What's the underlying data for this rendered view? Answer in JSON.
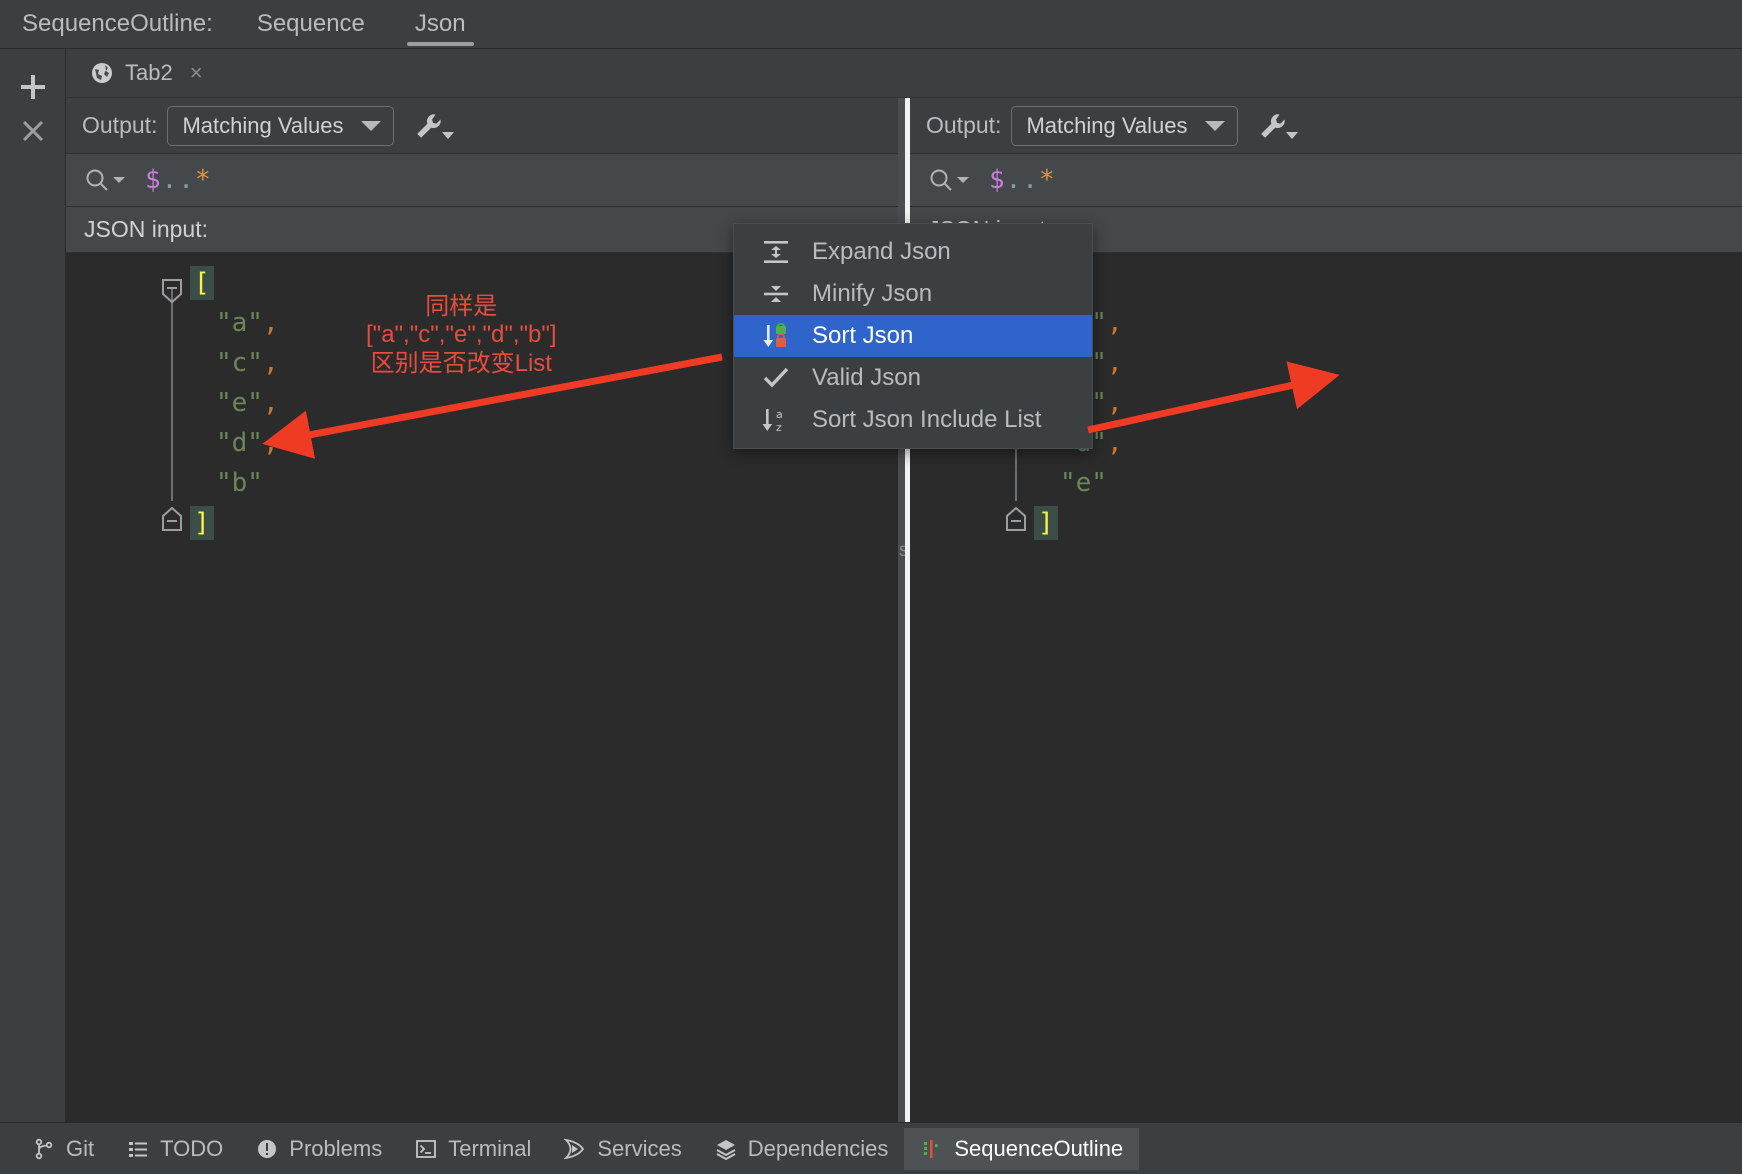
{
  "window": {
    "tool_window_title": "SequenceOutline:",
    "tabs": [
      {
        "label": "Sequence",
        "active": false
      },
      {
        "label": "Json",
        "active": true
      }
    ]
  },
  "rail": {
    "add_label": "+",
    "close_label": "×"
  },
  "editor_tabs": [
    {
      "label": "Tab2",
      "icon": "globe-icon",
      "close": "×"
    }
  ],
  "panes": {
    "left": {
      "output_label": "Output:",
      "output_value": "Matching Values",
      "wrench_icon": "wrench-icon",
      "search_placeholder": "$..*",
      "search_expression": "$..*",
      "json_input_label": "JSON input:",
      "code": {
        "open_bracket": "[",
        "close_bracket": "]",
        "items": [
          "\"a\"",
          "\"c\"",
          "\"e\"",
          "\"d\"",
          "\"b\""
        ],
        "separator": ","
      }
    },
    "right": {
      "output_label": "Output:",
      "output_value": "Matching Values",
      "wrench_icon": "wrench-icon",
      "search_placeholder": "$..*",
      "search_expression": "$..*",
      "json_input_label": "JSON input:",
      "code": {
        "open_bracket": "[",
        "close_bracket": "]",
        "items": [
          "\"a\"",
          "\"b\"",
          "\"c\"",
          "\"d\"",
          "\"e\""
        ],
        "separator": ","
      }
    }
  },
  "divider": {
    "mark": "s"
  },
  "context_menu": {
    "items": [
      {
        "label": "Expand Json",
        "icon": "expand-json-icon",
        "selected": false
      },
      {
        "label": "Minify Json",
        "icon": "minify-json-icon",
        "selected": false
      },
      {
        "label": "Sort Json",
        "icon": "sort-json-icon",
        "selected": true
      },
      {
        "label": "Valid Json",
        "icon": "check-icon",
        "selected": false
      },
      {
        "label": "Sort Json Include List",
        "icon": "sort-az-icon",
        "selected": false
      }
    ]
  },
  "annotation": {
    "line1": "同样是",
    "line2": "[\"a\",\"c\",\"e\",\"d\",\"b\"]",
    "line3": "区别是否改变List",
    "color": "#e74c3c"
  },
  "statusbar": {
    "items": [
      {
        "label": "Git",
        "icon": "git-branch-icon",
        "active": false
      },
      {
        "label": "TODO",
        "icon": "todo-list-icon",
        "active": false
      },
      {
        "label": "Problems",
        "icon": "problems-icon",
        "active": false
      },
      {
        "label": "Terminal",
        "icon": "terminal-icon",
        "active": false
      },
      {
        "label": "Services",
        "icon": "services-play-icon",
        "active": false
      },
      {
        "label": "Dependencies",
        "icon": "dependencies-icon",
        "active": false
      },
      {
        "label": "SequenceOutline",
        "icon": "sequence-outline-icon",
        "active": true
      }
    ]
  },
  "colors": {
    "accent_selection": "#2f65ca",
    "annotation_red": "#e74c3c",
    "string_green": "#6a8759",
    "punct_orange": "#cc7832",
    "bracket_yellow": "#f5f543",
    "background": "#2b2b2b",
    "chrome": "#3c3f41"
  }
}
